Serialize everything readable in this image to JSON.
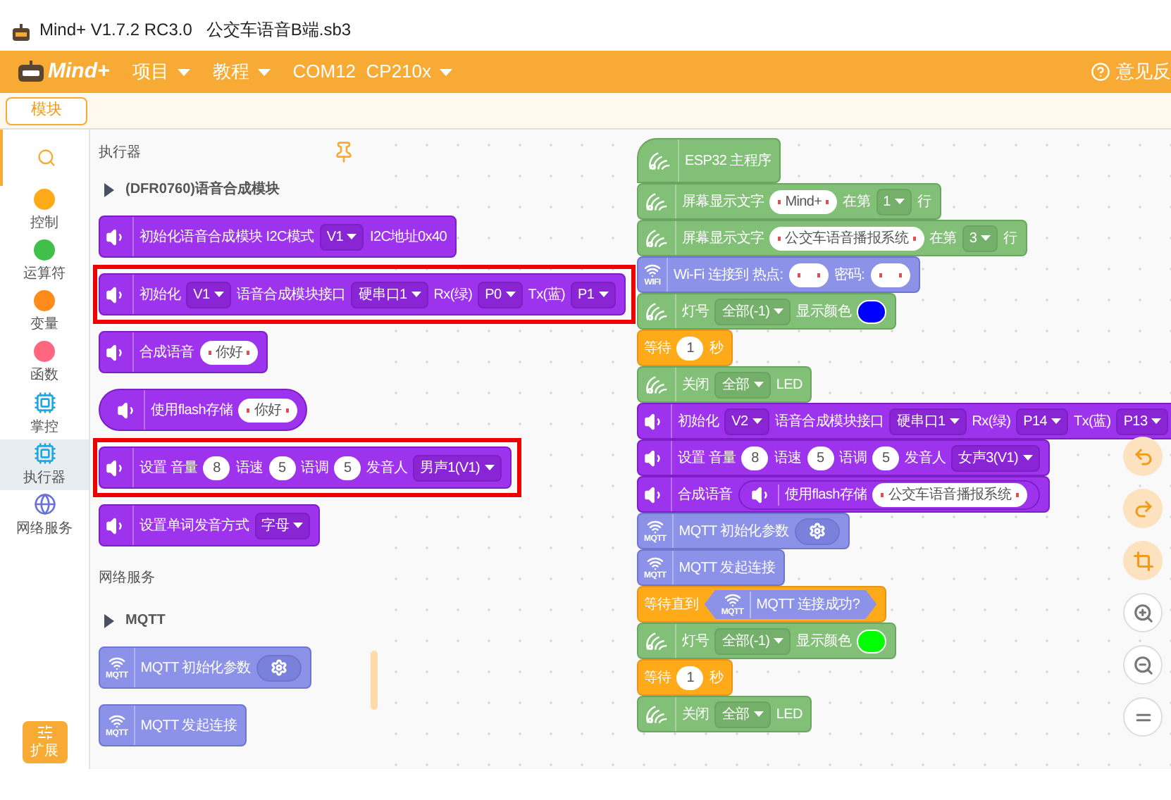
{
  "window": {
    "title": "Mind+ V1.7.2 RC3.0   公交车语音B端.sb3"
  },
  "menu_bar": {
    "logo": "Mind+",
    "menus": [
      {
        "label": "项目"
      },
      {
        "label": "教程"
      },
      {
        "label": "COM12  CP210x"
      }
    ],
    "feedback": "意见反"
  },
  "sub_bar": {
    "tab": "模块"
  },
  "categories": [
    {
      "kind": "search"
    },
    {
      "kind": "dot",
      "label": "控制",
      "color": "#ffab19",
      "selected": false
    },
    {
      "kind": "dot",
      "label": "运算符",
      "color": "#40bf4a",
      "selected": false
    },
    {
      "kind": "dot",
      "label": "变量",
      "color": "#ff8c1a",
      "selected": false
    },
    {
      "kind": "dot",
      "label": "函数",
      "color": "#ff6680",
      "selected": false
    },
    {
      "kind": "chip",
      "label": "掌控",
      "selected": false
    },
    {
      "kind": "chip",
      "label": "执行器",
      "selected": true
    },
    {
      "kind": "globe",
      "label": "网络服务",
      "selected": false
    }
  ],
  "extension_button": "扩展",
  "palette": {
    "title": "执行器",
    "items": [
      {
        "kind": "group",
        "label": "(DFR0760)语音合成模块"
      },
      {
        "kind": "voice",
        "highlighted": false,
        "parts": [
          {
            "kind": "text",
            "text": "初始化语音合成模块 I2C模式"
          },
          {
            "kind": "dropdown",
            "text": "V1"
          },
          {
            "kind": "text",
            "text": "I2C地址0x40"
          }
        ]
      },
      {
        "kind": "voice",
        "highlighted": true,
        "parts": [
          {
            "kind": "text",
            "text": "初始化"
          },
          {
            "kind": "dropdown",
            "text": "V1"
          },
          {
            "kind": "text",
            "text": "语音合成模块接口"
          },
          {
            "kind": "dropdown",
            "text": "硬串口1"
          },
          {
            "kind": "text",
            "text": "Rx(绿)"
          },
          {
            "kind": "dropdown",
            "text": "P0"
          },
          {
            "kind": "text",
            "text": "Tx(蓝)"
          },
          {
            "kind": "dropdown",
            "text": "P1"
          }
        ]
      },
      {
        "kind": "voice",
        "highlighted": false,
        "parts": [
          {
            "kind": "text",
            "text": "合成语音"
          },
          {
            "kind": "string",
            "text": "你好"
          }
        ]
      },
      {
        "kind": "voice",
        "reporter": true,
        "highlighted": false,
        "parts": [
          {
            "kind": "text",
            "text": "使用flash存储"
          },
          {
            "kind": "string",
            "text": "你好"
          }
        ]
      },
      {
        "kind": "voice",
        "highlighted": true,
        "parts": [
          {
            "kind": "text",
            "text": "设置 音量"
          },
          {
            "kind": "number",
            "text": "8"
          },
          {
            "kind": "text",
            "text": "语速"
          },
          {
            "kind": "number",
            "text": "5"
          },
          {
            "kind": "text",
            "text": "语调"
          },
          {
            "kind": "number",
            "text": "5"
          },
          {
            "kind": "text",
            "text": "发音人"
          },
          {
            "kind": "dropdown",
            "text": "男声1(V1)"
          }
        ]
      },
      {
        "kind": "voice",
        "highlighted": false,
        "parts": [
          {
            "kind": "text",
            "text": "设置单词发音方式"
          },
          {
            "kind": "dropdown",
            "text": "字母"
          }
        ]
      },
      {
        "kind": "section",
        "label": "网络服务"
      },
      {
        "kind": "group",
        "label": "MQTT"
      },
      {
        "kind": "network",
        "icon_label": "MQTT",
        "highlighted": false,
        "parts": [
          {
            "kind": "text",
            "text": "MQTT 初始化参数"
          },
          {
            "kind": "gear"
          }
        ]
      },
      {
        "kind": "network",
        "icon_label": "MQTT",
        "highlighted": false,
        "parts": [
          {
            "kind": "text",
            "text": "MQTT 发起连接"
          }
        ]
      }
    ]
  },
  "script": {
    "blocks": [
      {
        "kind": "board",
        "hat": true,
        "parts": [
          {
            "kind": "text",
            "text": "ESP32 主程序"
          }
        ]
      },
      {
        "kind": "board",
        "parts": [
          {
            "kind": "text",
            "text": "屏幕显示文字"
          },
          {
            "kind": "string",
            "text": "Mind+"
          },
          {
            "kind": "text",
            "text": "在第"
          },
          {
            "kind": "dropdown",
            "text": "1"
          },
          {
            "kind": "text",
            "text": "行"
          }
        ]
      },
      {
        "kind": "board",
        "parts": [
          {
            "kind": "text",
            "text": "屏幕显示文字"
          },
          {
            "kind": "string",
            "text": "公交车语音播报系统"
          },
          {
            "kind": "text",
            "text": "在第"
          },
          {
            "kind": "dropdown",
            "text": "3"
          },
          {
            "kind": "text",
            "text": "行"
          }
        ]
      },
      {
        "kind": "network",
        "icon_label": "WIFI",
        "parts": [
          {
            "kind": "text",
            "text": "Wi-Fi 连接到 热点:"
          },
          {
            "kind": "string"
          },
          {
            "kind": "text",
            "text": "密码:"
          },
          {
            "kind": "string"
          }
        ]
      },
      {
        "kind": "board",
        "parts": [
          {
            "kind": "text",
            "text": "灯号"
          },
          {
            "kind": "dropdown",
            "text": "全部(-1)"
          },
          {
            "kind": "text",
            "text": "显示颜色"
          },
          {
            "kind": "color",
            "color": "#0000ff"
          }
        ]
      },
      {
        "kind": "control",
        "parts": [
          {
            "kind": "text",
            "text": "等待"
          },
          {
            "kind": "number",
            "text": "1"
          },
          {
            "kind": "text",
            "text": "秒"
          }
        ]
      },
      {
        "kind": "board",
        "parts": [
          {
            "kind": "text",
            "text": "关闭"
          },
          {
            "kind": "dropdown",
            "text": "全部"
          },
          {
            "kind": "text",
            "text": "LED"
          }
        ]
      },
      {
        "kind": "voice",
        "parts": [
          {
            "kind": "text",
            "text": "初始化"
          },
          {
            "kind": "dropdown",
            "text": "V2"
          },
          {
            "kind": "text",
            "text": "语音合成模块接口"
          },
          {
            "kind": "dropdown",
            "text": "硬串口1"
          },
          {
            "kind": "text",
            "text": "Rx(绿)"
          },
          {
            "kind": "dropdown",
            "text": "P14"
          },
          {
            "kind": "text",
            "text": "Tx(蓝)"
          },
          {
            "kind": "dropdown",
            "text": "P13"
          }
        ]
      },
      {
        "kind": "voice",
        "parts": [
          {
            "kind": "text",
            "text": "设置 音量"
          },
          {
            "kind": "number",
            "text": "8"
          },
          {
            "kind": "text",
            "text": "语速"
          },
          {
            "kind": "number",
            "text": "5"
          },
          {
            "kind": "text",
            "text": "语调"
          },
          {
            "kind": "number",
            "text": "5"
          },
          {
            "kind": "text",
            "text": "发音人"
          },
          {
            "kind": "dropdown",
            "text": "女声3(V1)"
          }
        ]
      },
      {
        "kind": "voice",
        "parts": [
          {
            "kind": "text",
            "text": "合成语音"
          },
          {
            "kind": "voice_reporter",
            "parts": [
              {
                "kind": "text",
                "text": "使用flash存储"
              },
              {
                "kind": "string",
                "text": "公交车语音播报系统"
              }
            ]
          }
        ]
      },
      {
        "kind": "network",
        "icon_label": "MQTT",
        "parts": [
          {
            "kind": "text",
            "text": "MQTT 初始化参数"
          },
          {
            "kind": "gear"
          }
        ]
      },
      {
        "kind": "network",
        "icon_label": "MQTT",
        "parts": [
          {
            "kind": "text",
            "text": "MQTT 发起连接"
          }
        ]
      },
      {
        "kind": "control",
        "parts": [
          {
            "kind": "text",
            "text": "等待直到"
          },
          {
            "kind": "network_boolean",
            "icon_label": "MQTT",
            "parts": [
              {
                "kind": "text",
                "text": "MQTT 连接成功?"
              }
            ]
          }
        ]
      },
      {
        "kind": "board",
        "parts": [
          {
            "kind": "text",
            "text": "灯号"
          },
          {
            "kind": "dropdown",
            "text": "全部(-1)"
          },
          {
            "kind": "text",
            "text": "显示颜色"
          },
          {
            "kind": "color",
            "color": "#00ff00"
          }
        ]
      },
      {
        "kind": "control",
        "parts": [
          {
            "kind": "text",
            "text": "等待"
          },
          {
            "kind": "number",
            "text": "1"
          },
          {
            "kind": "text",
            "text": "秒"
          }
        ]
      },
      {
        "kind": "board",
        "parts": [
          {
            "kind": "text",
            "text": "关闭"
          },
          {
            "kind": "dropdown",
            "text": "全部"
          },
          {
            "kind": "text",
            "text": "LED"
          }
        ]
      }
    ]
  },
  "canvas_tools": [
    {
      "kind": "undo"
    },
    {
      "kind": "redo"
    },
    {
      "kind": "crop"
    },
    {
      "kind": "zoom_in"
    },
    {
      "kind": "zoom_out"
    },
    {
      "kind": "reset"
    }
  ]
}
